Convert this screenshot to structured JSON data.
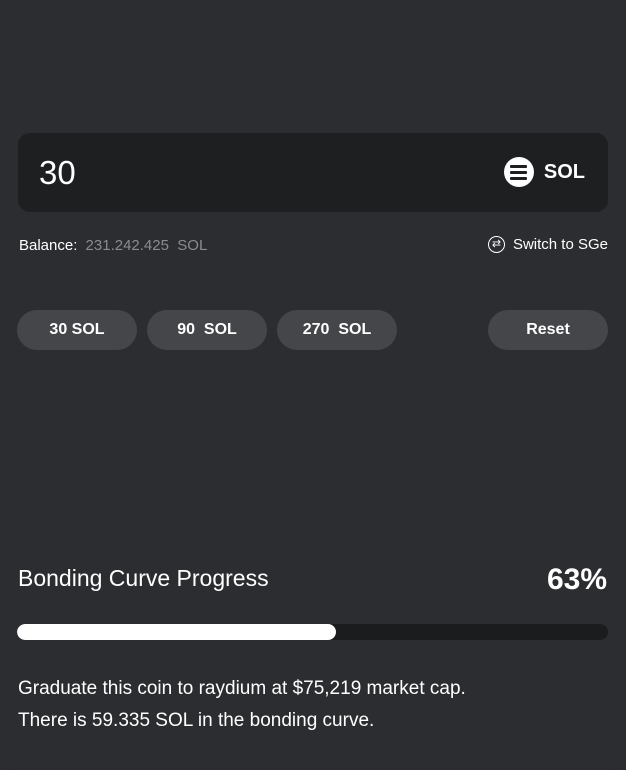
{
  "amount": {
    "value": "30",
    "token": "SOL",
    "token_icon": "solana-icon"
  },
  "balance": {
    "label": "Balance:",
    "value": "231.242.425  SOL"
  },
  "switch": {
    "label": "Switch to SGe",
    "icon": "swap-icon"
  },
  "quick_amounts": [
    "30 SOL",
    "90  SOL",
    "270  SOL"
  ],
  "reset_label": "Reset",
  "progress": {
    "title": "Bonding Curve Progress",
    "percent_label": "63%",
    "fraction": 0.54
  },
  "info": {
    "line1": "Graduate this coin to raydium at $75,219 market cap.",
    "line2": "There is 59.335 SOL in the bonding curve."
  }
}
